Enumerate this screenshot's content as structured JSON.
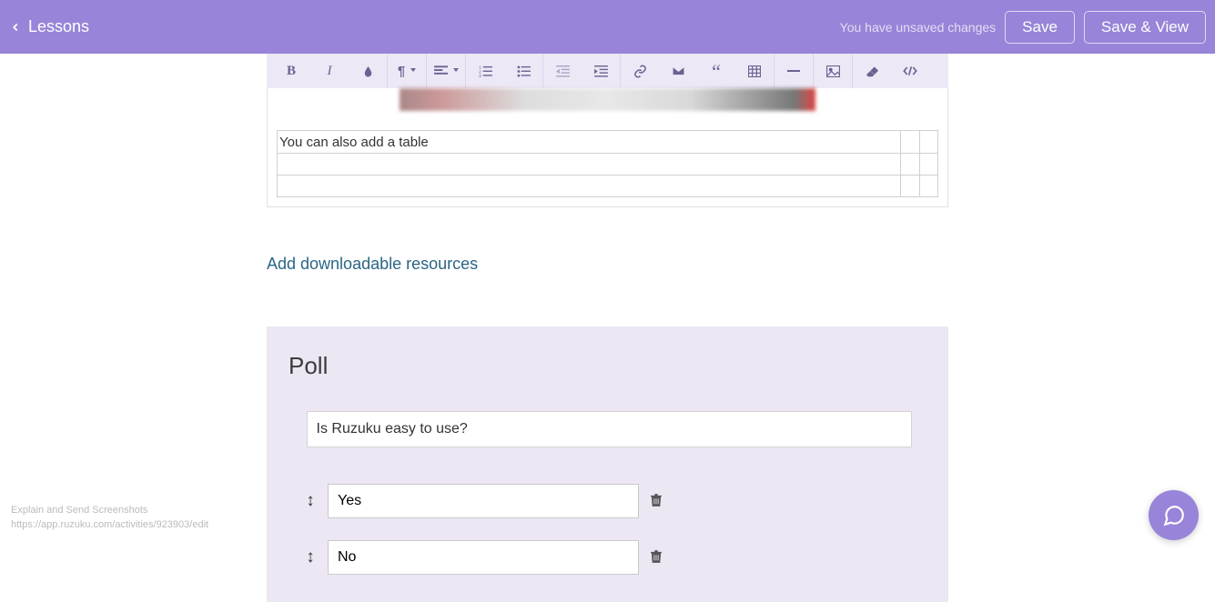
{
  "header": {
    "back_label": "Lessons",
    "unsaved_text": "You have unsaved changes",
    "save_label": "Save",
    "save_view_label": "Save & View"
  },
  "editor": {
    "table_cell": "You can also add a table"
  },
  "resources": {
    "add_label": "Add downloadable resources"
  },
  "poll": {
    "title": "Poll",
    "question": "Is Ruzuku easy to use?",
    "options": [
      "Yes",
      "No"
    ]
  },
  "footer": {
    "caption_line1": "Explain and Send Screenshots",
    "caption_line2": "https://app.ruzuku.com/activities/923903/edit"
  },
  "toolbar_icons": {
    "bold": "B",
    "italic": "I",
    "color": "color",
    "paragraph": "paragraph",
    "align": "align",
    "ol": "ol",
    "ul": "ul",
    "outdent": "outdent",
    "indent": "indent",
    "link": "link",
    "email": "email",
    "quote": "quote",
    "table": "table",
    "hr": "hr",
    "image": "image",
    "eraser": "eraser",
    "code": "code"
  }
}
